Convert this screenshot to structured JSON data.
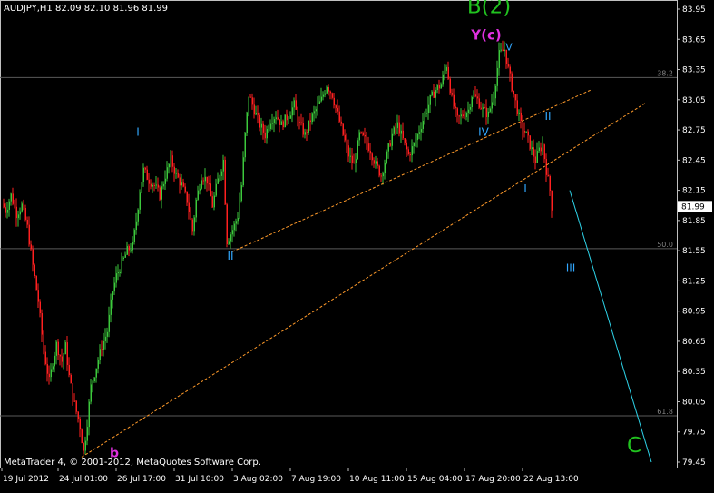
{
  "chart_data": {
    "type": "candlestick",
    "header": "AUDJPY,H1  82.09 82.10 81.96 81.99",
    "footer": "MetaTrader 4, © 2001-2012, MetaQuotes Software Corp.",
    "ylim": [
      79.45,
      83.97
    ],
    "y_ticks": [
      "83.95",
      "83.65",
      "83.35",
      "83.05",
      "82.75",
      "82.45",
      "82.15",
      "81.85",
      "81.55",
      "81.25",
      "80.95",
      "80.65",
      "80.35",
      "80.05",
      "79.75",
      "79.45"
    ],
    "current_price": "81.99",
    "x_ticks": [
      "19 Jul 2012",
      "24 Jul 01:00",
      "26 Jul 17:00",
      "31 Jul 10:00",
      "3 Aug 02:00",
      "7 Aug 19:00",
      "10 Aug 11:00",
      "15 Aug 04:00",
      "17 Aug 20:00",
      "22 Aug 13:00"
    ],
    "fib_levels": [
      {
        "label": "38.2",
        "price": 83.27
      },
      {
        "label": "50.0",
        "price": 81.57
      },
      {
        "label": "61.8",
        "price": 79.91
      }
    ],
    "close_path": [
      [
        0,
        82.05
      ],
      [
        6,
        81.95
      ],
      [
        12,
        82.1
      ],
      [
        18,
        81.92
      ],
      [
        24,
        82.0
      ],
      [
        30,
        81.78
      ],
      [
        36,
        81.4
      ],
      [
        42,
        81.05
      ],
      [
        48,
        80.55
      ],
      [
        54,
        80.25
      ],
      [
        58,
        80.45
      ],
      [
        62,
        80.62
      ],
      [
        68,
        80.45
      ],
      [
        72,
        80.6
      ],
      [
        76,
        80.3
      ],
      [
        80,
        80.1
      ],
      [
        84,
        79.95
      ],
      [
        88,
        79.8
      ],
      [
        92,
        79.55
      ],
      [
        96,
        79.85
      ],
      [
        100,
        80.2
      ],
      [
        106,
        80.4
      ],
      [
        112,
        80.6
      ],
      [
        118,
        80.75
      ],
      [
        124,
        81.15
      ],
      [
        128,
        81.3
      ],
      [
        134,
        81.42
      ],
      [
        140,
        81.55
      ],
      [
        146,
        81.6
      ],
      [
        150,
        81.85
      ],
      [
        154,
        82.15
      ],
      [
        158,
        82.35
      ],
      [
        164,
        82.25
      ],
      [
        170,
        82.2
      ],
      [
        176,
        82.1
      ],
      [
        182,
        82.3
      ],
      [
        188,
        82.45
      ],
      [
        194,
        82.3
      ],
      [
        200,
        82.2
      ],
      [
        206,
        82.05
      ],
      [
        212,
        81.75
      ],
      [
        216,
        82.05
      ],
      [
        222,
        82.3
      ],
      [
        228,
        82.25
      ],
      [
        234,
        82.0
      ],
      [
        240,
        82.25
      ],
      [
        246,
        82.45
      ],
      [
        250,
        81.65
      ],
      [
        254,
        81.72
      ],
      [
        258,
        81.8
      ],
      [
        262,
        81.9
      ],
      [
        266,
        82.2
      ],
      [
        270,
        82.7
      ],
      [
        274,
        83.1
      ],
      [
        280,
        82.95
      ],
      [
        286,
        82.8
      ],
      [
        292,
        82.7
      ],
      [
        298,
        82.85
      ],
      [
        304,
        82.9
      ],
      [
        310,
        82.8
      ],
      [
        318,
        82.9
      ],
      [
        324,
        83.0
      ],
      [
        330,
        82.8
      ],
      [
        336,
        82.7
      ],
      [
        342,
        82.85
      ],
      [
        348,
        82.95
      ],
      [
        354,
        83.05
      ],
      [
        360,
        83.2
      ],
      [
        366,
        83.1
      ],
      [
        372,
        82.9
      ],
      [
        378,
        82.7
      ],
      [
        384,
        82.5
      ],
      [
        390,
        82.4
      ],
      [
        396,
        82.7
      ],
      [
        402,
        82.65
      ],
      [
        408,
        82.55
      ],
      [
        414,
        82.4
      ],
      [
        420,
        82.3
      ],
      [
        426,
        82.5
      ],
      [
        432,
        82.7
      ],
      [
        438,
        82.8
      ],
      [
        444,
        82.65
      ],
      [
        450,
        82.5
      ],
      [
        456,
        82.6
      ],
      [
        462,
        82.75
      ],
      [
        468,
        82.9
      ],
      [
        474,
        83.05
      ],
      [
        480,
        83.15
      ],
      [
        486,
        83.2
      ],
      [
        492,
        83.4
      ],
      [
        498,
        83.05
      ],
      [
        504,
        82.85
      ],
      [
        510,
        82.9
      ],
      [
        516,
        82.95
      ],
      [
        520,
        83.1
      ],
      [
        526,
        83.05
      ],
      [
        532,
        82.95
      ],
      [
        538,
        82.9
      ],
      [
        544,
        83.1
      ],
      [
        550,
        83.5
      ],
      [
        556,
        83.55
      ],
      [
        560,
        83.35
      ],
      [
        566,
        83.1
      ],
      [
        570,
        82.95
      ],
      [
        574,
        82.8
      ],
      [
        580,
        82.7
      ],
      [
        586,
        82.55
      ],
      [
        590,
        82.45
      ],
      [
        594,
        82.55
      ],
      [
        598,
        82.6
      ],
      [
        602,
        82.35
      ],
      [
        606,
        82.15
      ],
      [
        608,
        81.99
      ]
    ],
    "orange_lines": [
      {
        "name": "upper channel",
        "p1": [
          256,
          81.54
        ],
        "p2": [
          652,
          83.15
        ]
      },
      {
        "name": "lower channel",
        "p1": [
          90,
          79.5
        ],
        "p2": [
          712,
          83.02
        ]
      }
    ],
    "projection_line": {
      "p1": [
        628,
        82.15
      ],
      "p2": [
        718,
        79.45
      ]
    },
    "wave_labels": [
      {
        "text": "B(2)",
        "x": 539,
        "price": 83.91,
        "color": "#21c21f",
        "size": 23
      },
      {
        "text": "Y(c)",
        "x": 536,
        "price": 83.65,
        "color": "#e030e0",
        "size": 15,
        "bold": true
      },
      {
        "text": "V",
        "x": 561,
        "price": 83.54,
        "color": "#32a8ff",
        "size": 11
      },
      {
        "text": "I",
        "x": 152,
        "price": 82.69,
        "color": "#32a8ff",
        "size": 12
      },
      {
        "text": "II",
        "x": 254,
        "price": 81.46,
        "color": "#32a8ff",
        "size": 12
      },
      {
        "text": "IV",
        "x": 533,
        "price": 82.69,
        "color": "#32a8ff",
        "size": 12
      },
      {
        "text": "II",
        "x": 604,
        "price": 82.85,
        "color": "#32a8ff",
        "size": 12
      },
      {
        "text": "I",
        "x": 579,
        "price": 82.13,
        "color": "#32a8ff",
        "size": 12
      },
      {
        "text": "III",
        "x": 629,
        "price": 81.34,
        "color": "#32a8ff",
        "size": 12
      },
      {
        "text": "b",
        "x": 126,
        "price": 79.5,
        "color": "#e030e0",
        "size": 14,
        "bold": true
      },
      {
        "text": "C",
        "x": 699,
        "price": 79.55,
        "color": "#21c21f",
        "size": 23
      }
    ]
  }
}
